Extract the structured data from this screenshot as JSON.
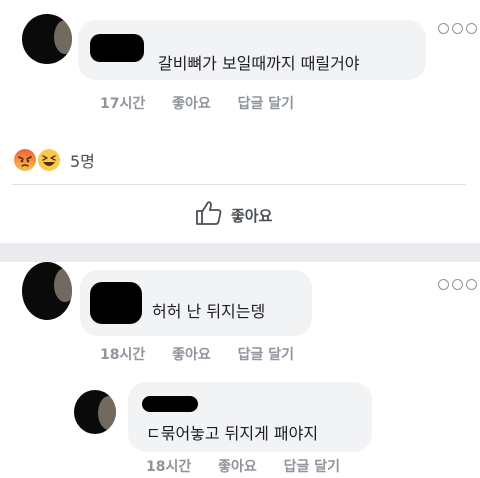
{
  "comments": [
    {
      "text": "갈비뼈가 보일때까지 때릴거야",
      "time": "17시간",
      "like": "좋아요",
      "reply": "답글 달기"
    },
    {
      "text": "허허 난 뒤지는뎅",
      "time": "18시간",
      "like": "좋아요",
      "reply": "답글 달기"
    },
    {
      "text": "ㄷ묶어놓고 뒤지게 패야지",
      "time": "18시간",
      "like": "좋아요",
      "reply": "답글 달기"
    }
  ],
  "reactions": {
    "icons": [
      "angry-icon",
      "haha-icon"
    ],
    "count": "5명"
  },
  "like_action": {
    "icon": "thumbs-up-icon",
    "label": "좋아요"
  },
  "colors": {
    "background": "#e9ebee",
    "card": "#ffffff",
    "bubble": "#f2f3f5",
    "meta_text": "#90949c",
    "body_text": "#1c1e21"
  }
}
